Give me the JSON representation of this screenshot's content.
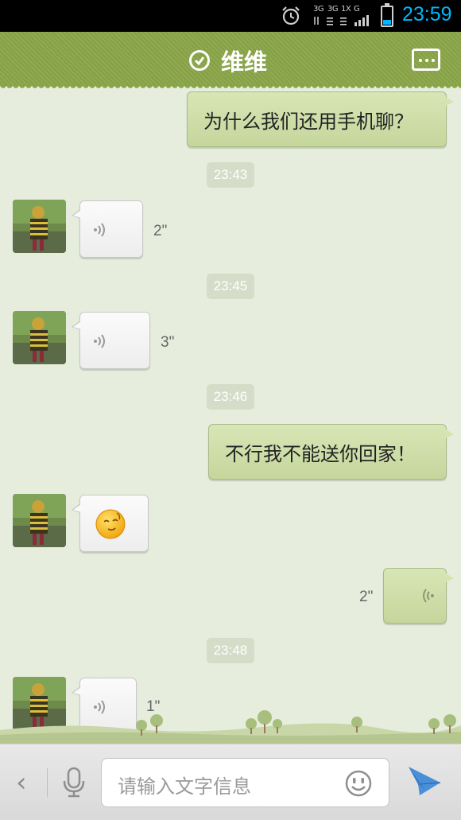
{
  "status_bar": {
    "network_labels": [
      "3G",
      "3G",
      "1X",
      "G"
    ],
    "time": "23:59",
    "accent_color": "#00b7ff",
    "icons": [
      "alarm-icon",
      "signal-icon",
      "battery-icon"
    ]
  },
  "header": {
    "title": "维维",
    "status_icon": "check-circle-icon",
    "menu_icon": "more-dots-icon",
    "color": "#8aa548"
  },
  "messages": [
    {
      "type": "text",
      "side": "out",
      "text": "为什么我们还用手机聊？"
    },
    {
      "type": "timestamp",
      "text": "23:43"
    },
    {
      "type": "voice",
      "side": "in",
      "duration": "2\""
    },
    {
      "type": "timestamp",
      "text": "23:45"
    },
    {
      "type": "voice",
      "side": "in",
      "duration": "3\""
    },
    {
      "type": "timestamp",
      "text": "23:46"
    },
    {
      "type": "text",
      "side": "out",
      "text": "不行我不能送你回家！"
    },
    {
      "type": "emoji",
      "side": "in",
      "icon": "shy-smile-emoji-icon"
    },
    {
      "type": "voice",
      "side": "out",
      "duration": "2\""
    },
    {
      "type": "timestamp",
      "text": "23:48"
    },
    {
      "type": "voice",
      "side": "in",
      "duration": "1\""
    }
  ],
  "input_bar": {
    "placeholder": "请输入文字信息",
    "icons": [
      "back-chevron-icon",
      "microphone-icon",
      "smiley-icon",
      "send-icon"
    ]
  }
}
